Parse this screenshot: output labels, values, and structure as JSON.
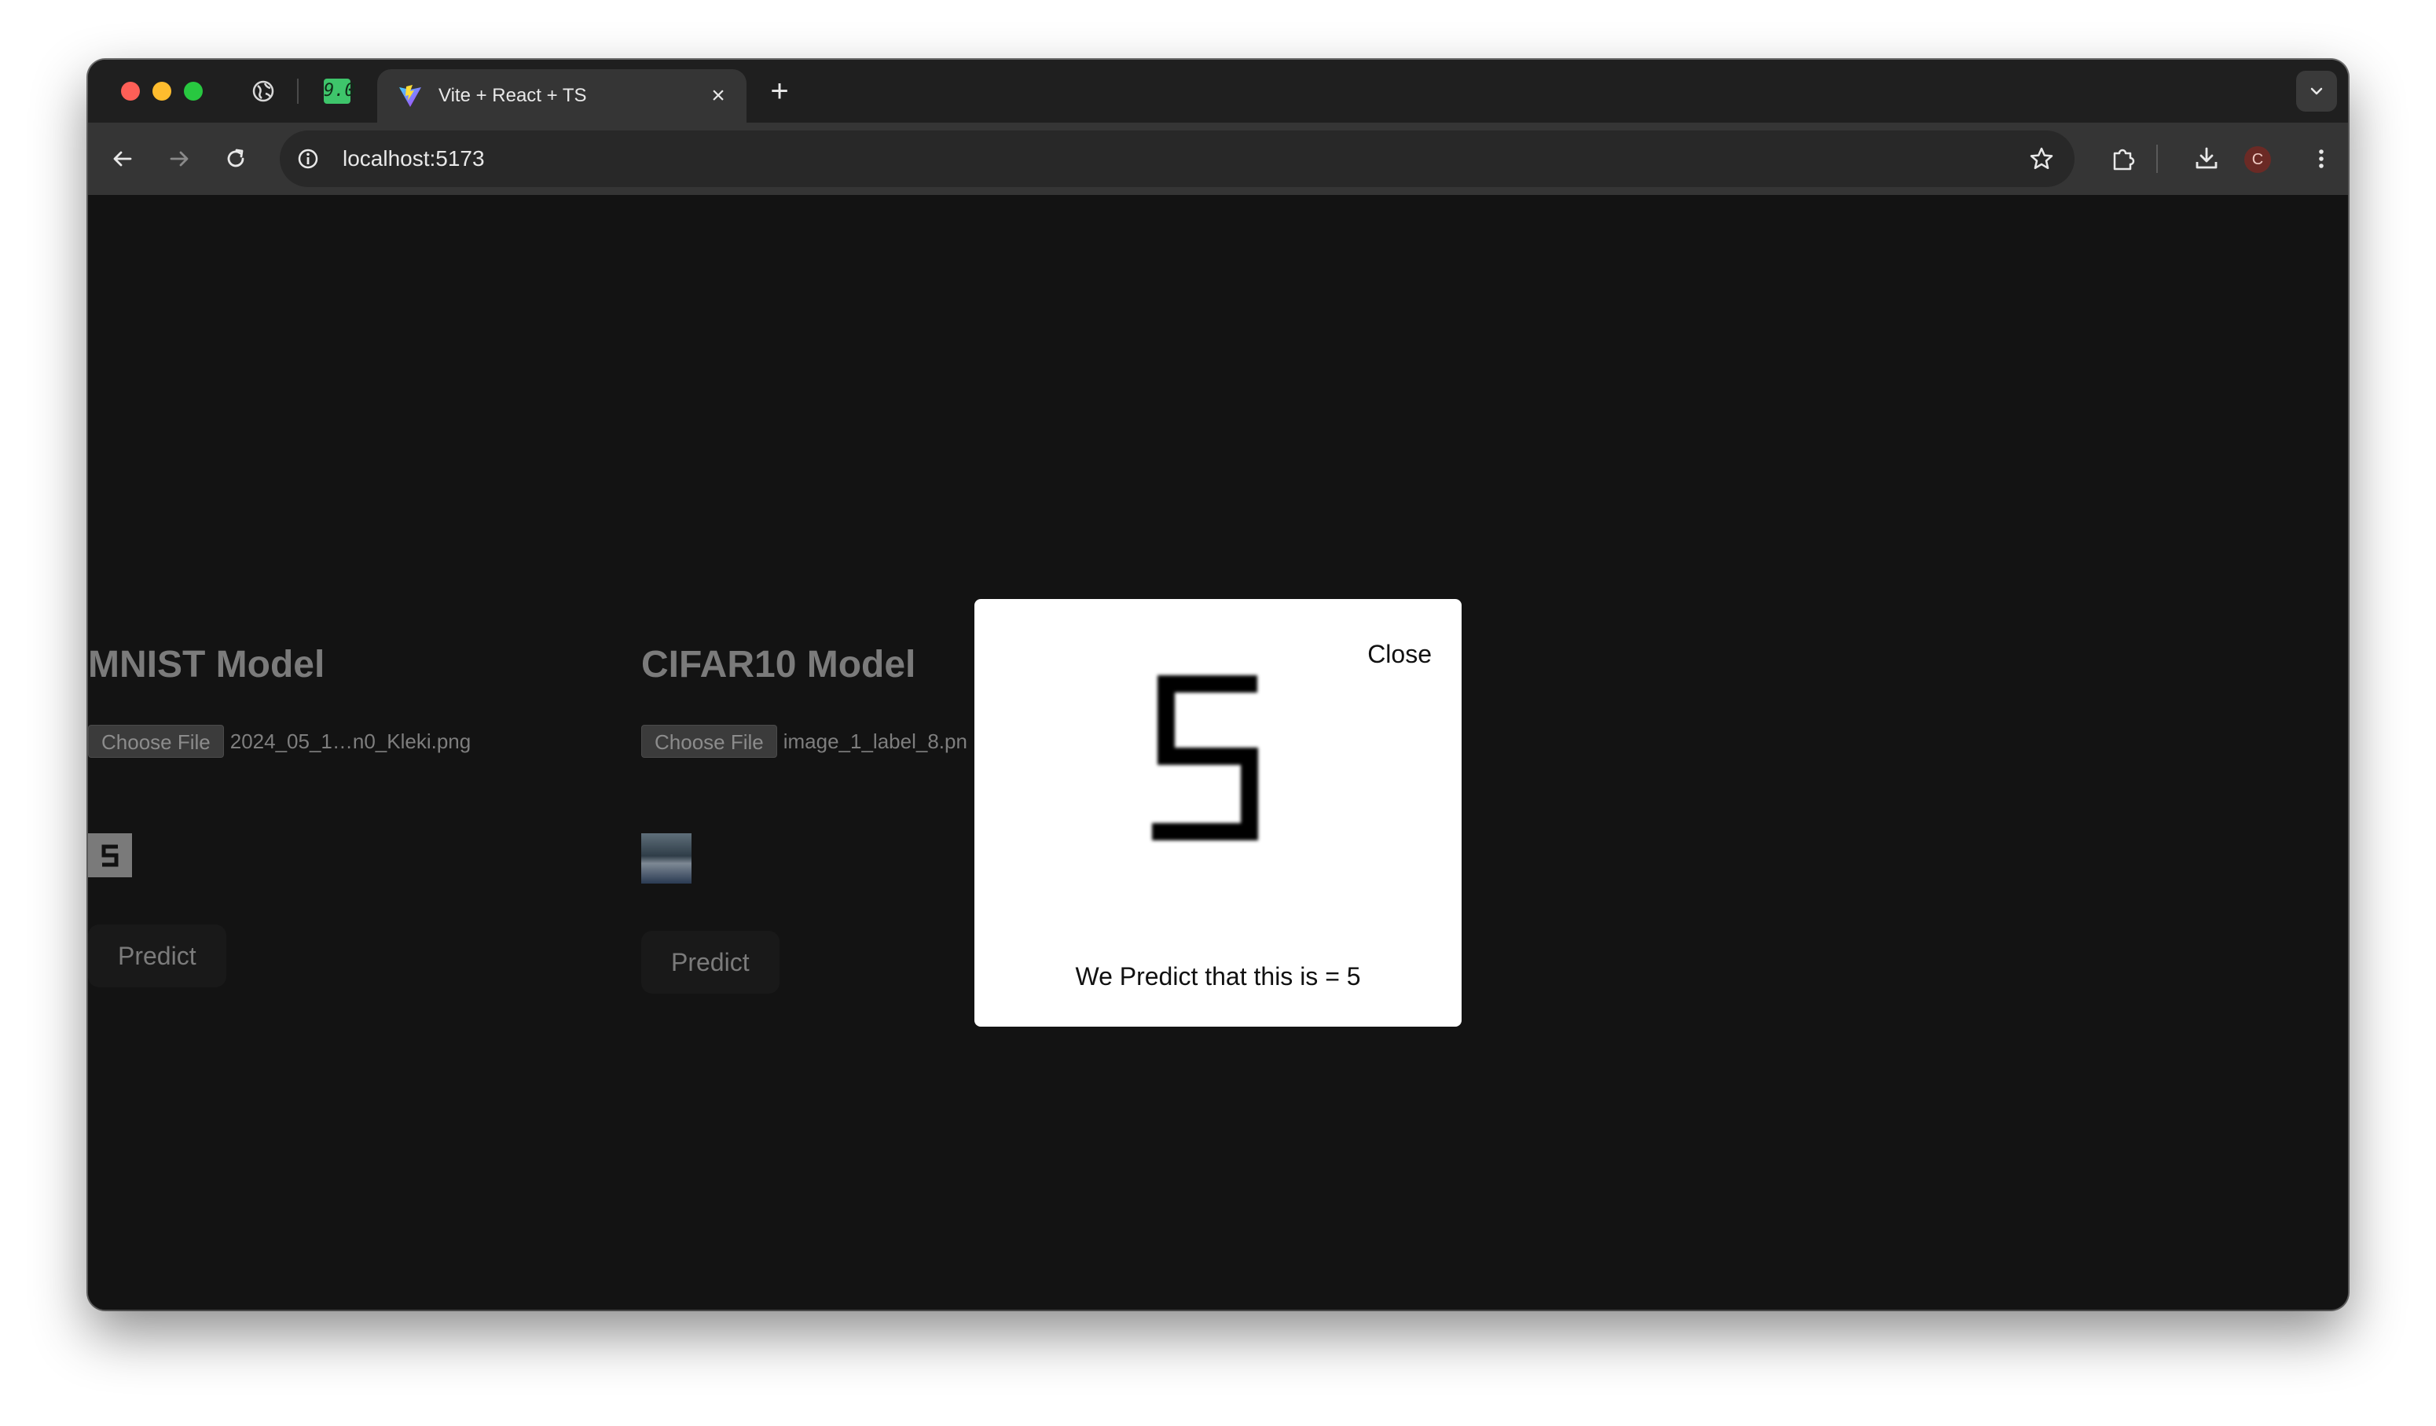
{
  "browser": {
    "active_tab": {
      "title": "Vite + React + TS"
    },
    "pinned_badge": "9.0",
    "address_bar": {
      "url": "localhost:5173"
    },
    "profile_initial": "C"
  },
  "page": {
    "mnist": {
      "title": "MNIST Model",
      "choose_file_label": "Choose File",
      "file_name": "2024_05_1…n0_Kleki.png",
      "predict_label": "Predict"
    },
    "cifar": {
      "title": "CIFAR10 Model",
      "choose_file_label": "Choose File",
      "file_name": "image_1_label_8.pn",
      "predict_label": "Predict"
    }
  },
  "modal": {
    "close_label": "Close",
    "result_text": "We Predict that this is = 5"
  },
  "colors": {
    "traffic_red": "#fe5f57",
    "traffic_yellow": "#febc2e",
    "traffic_green": "#28c840",
    "page_background": "#131313",
    "modal_background": "#ffffff"
  }
}
